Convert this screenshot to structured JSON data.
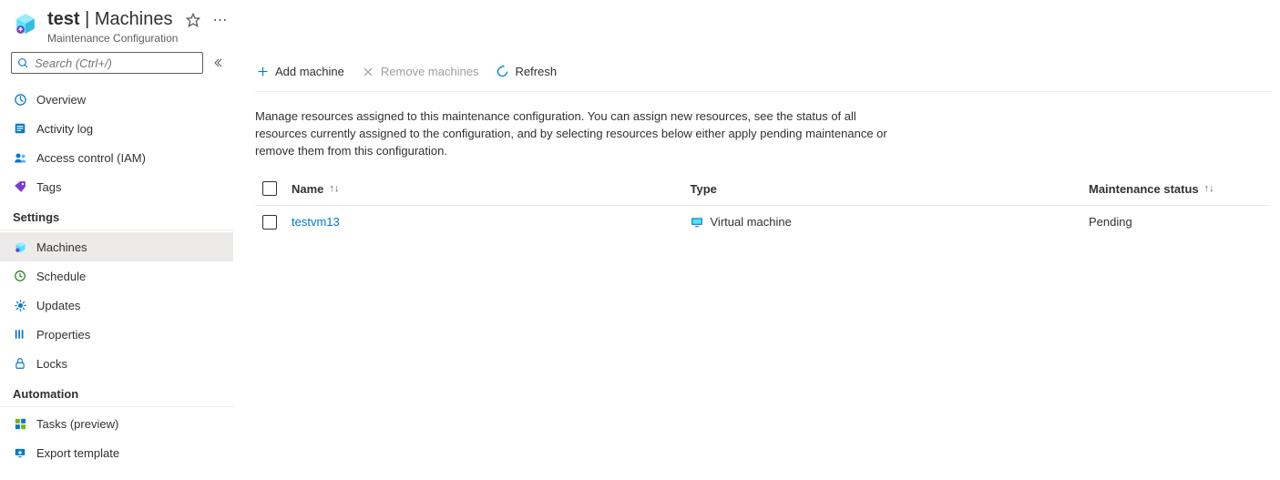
{
  "header": {
    "resource_name": "test",
    "separator": " | ",
    "page_name": "Machines",
    "subtitle": "Maintenance Configuration"
  },
  "sidebar": {
    "search_placeholder": "Search (Ctrl+/)",
    "top_items": [
      {
        "label": "Overview"
      },
      {
        "label": "Activity log"
      },
      {
        "label": "Access control (IAM)"
      },
      {
        "label": "Tags"
      }
    ],
    "sections": [
      {
        "title": "Settings",
        "items": [
          {
            "label": "Machines",
            "active": true
          },
          {
            "label": "Schedule"
          },
          {
            "label": "Updates"
          },
          {
            "label": "Properties"
          },
          {
            "label": "Locks"
          }
        ]
      },
      {
        "title": "Automation",
        "items": [
          {
            "label": "Tasks (preview)"
          },
          {
            "label": "Export template"
          }
        ]
      }
    ]
  },
  "toolbar": {
    "add_label": "Add machine",
    "remove_label": "Remove machines",
    "refresh_label": "Refresh"
  },
  "description": "Manage resources assigned to this maintenance configuration. You can assign new resources, see the status of all resources currently assigned to the configuration, and by selecting resources below either apply pending maintenance or remove them from this configuration.",
  "table": {
    "columns": {
      "name": "Name",
      "type": "Type",
      "status": "Maintenance status"
    },
    "rows": [
      {
        "name": "testvm13",
        "type": "Virtual machine",
        "status": "Pending"
      }
    ]
  }
}
